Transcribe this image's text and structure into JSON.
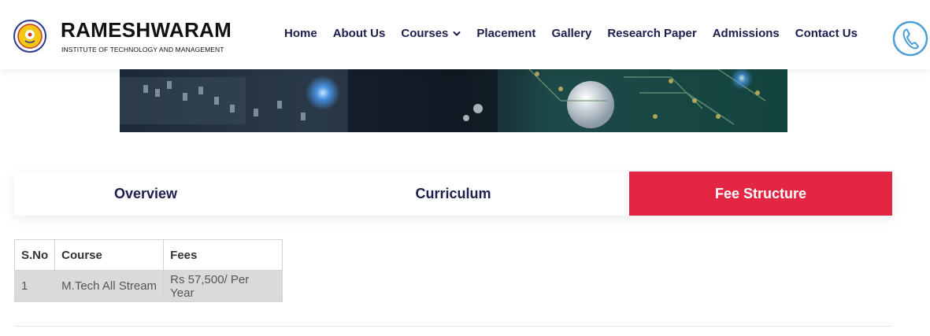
{
  "brand": {
    "name": "RAMESHWARAM",
    "subtitle": "INSTITUTE OF TECHNOLOGY AND MANAGEMENT",
    "logo_icon": "college-seal-icon"
  },
  "nav": {
    "items": [
      {
        "label": "Home"
      },
      {
        "label": "About Us"
      },
      {
        "label": "Courses",
        "has_dropdown": true
      },
      {
        "label": "Placement"
      },
      {
        "label": "Gallery"
      },
      {
        "label": "Research Paper"
      },
      {
        "label": "Admissions"
      },
      {
        "label": "Contact Us"
      }
    ],
    "phone_icon": "phone-icon"
  },
  "tabs": [
    {
      "label": "Overview",
      "active": false
    },
    {
      "label": "Curriculum",
      "active": false
    },
    {
      "label": "Fee Structure",
      "active": true
    }
  ],
  "fee_table": {
    "headers": [
      "S.No",
      "Course",
      "Fees"
    ],
    "rows": [
      [
        "1",
        "M.Tech All Stream",
        "Rs 57,500/ Per Year"
      ]
    ]
  },
  "colors": {
    "accent": "#e22644",
    "nav_text": "#1b1f4d",
    "phone_blue": "#4a9fd8"
  }
}
